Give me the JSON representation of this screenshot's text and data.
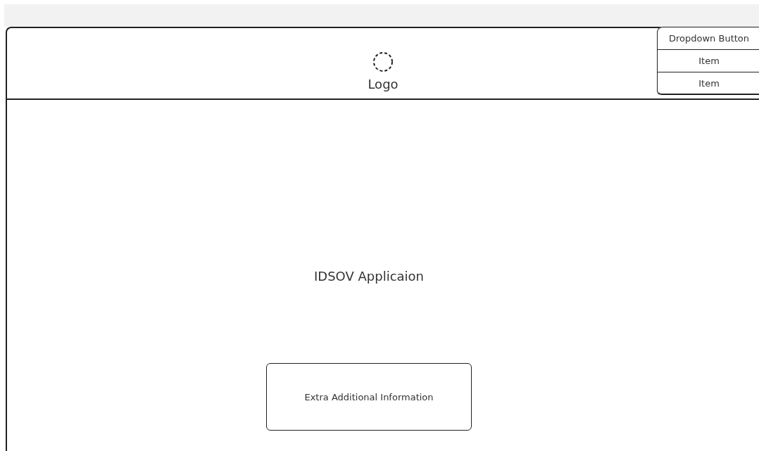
{
  "header": {
    "logo": {
      "label": "Logo"
    },
    "dropdown": {
      "label": "Dropdown Button",
      "expanded": true,
      "items": [
        {
          "label": "Item"
        },
        {
          "label": "Item"
        }
      ]
    }
  },
  "main": {
    "title": "IDSOV Applicaion",
    "info_box": {
      "text": "Extra Additional Information"
    }
  }
}
